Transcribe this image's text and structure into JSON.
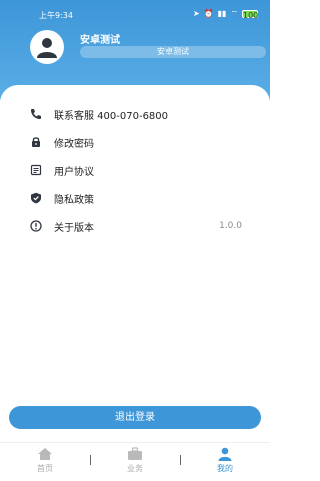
{
  "status": {
    "time": "上午9:34",
    "battery": "100"
  },
  "user": {
    "name": "安卓测试",
    "subtitle": "安卓测试"
  },
  "menu": [
    {
      "label": "联系客服 400-070-6800",
      "value": "",
      "icon": "phone-icon"
    },
    {
      "label": "修改密码",
      "value": "",
      "icon": "lock-icon"
    },
    {
      "label": "用户协议",
      "value": "",
      "icon": "document-icon"
    },
    {
      "label": "隐私政策",
      "value": "",
      "icon": "shield-icon"
    },
    {
      "label": "关于版本",
      "value": "1.0.0",
      "icon": "info-icon"
    }
  ],
  "logout_label": "退出登录",
  "tabs": [
    {
      "label": "首页",
      "icon": "home-icon"
    },
    {
      "label": "业务",
      "icon": "briefcase-icon"
    },
    {
      "label": "我的",
      "icon": "user-icon"
    }
  ],
  "colors": {
    "accent": "#3d96d8",
    "icon_dark": "#2f3640"
  }
}
